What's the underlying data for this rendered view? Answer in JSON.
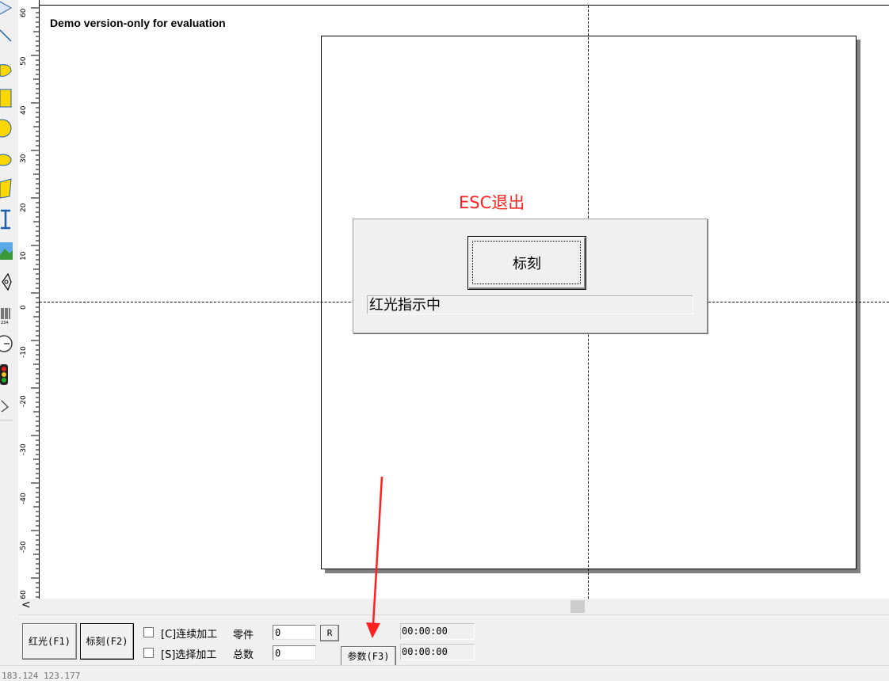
{
  "canvas": {
    "demo_text": "Demo version-only for evaluation",
    "esc_label": "ESC退出"
  },
  "ruler": {
    "labels": [
      "60",
      "50",
      "40",
      "30",
      "20",
      "10",
      "0",
      "-10",
      "-20",
      "-30",
      "-40",
      "-50",
      "-60"
    ]
  },
  "dialog": {
    "mark_button_label": "标刻",
    "status_text": "红光指示中"
  },
  "bottom": {
    "red_light_button": "红光(F1)",
    "mark_button": "标刻(F2)",
    "continuous_label": "[C]连续加工",
    "select_label": "[S]选择加工",
    "parts_label": "零件",
    "total_label": "总数",
    "parts_value": "0",
    "total_value": "0",
    "reset_button": "R",
    "params_button": "参数(F3)",
    "time1": "00:00:00",
    "time2": "00:00:00"
  },
  "scrollbar": {
    "left_arrow": "<"
  },
  "statusbar": {
    "text": "183.124 123.177"
  },
  "colors": {
    "annotation_red": "#ff2020",
    "window_bg": "#f0f0f0"
  }
}
